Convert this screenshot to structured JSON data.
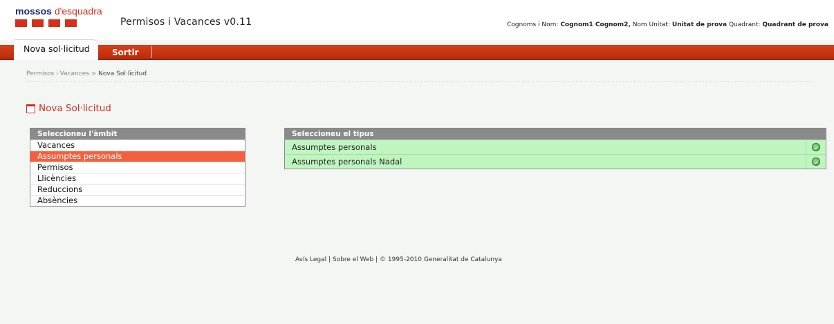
{
  "header": {
    "logo": {
      "bold": "mossos",
      "light": "d'esquadra"
    },
    "app_title": "Permisos i Vacances v0.11",
    "user": {
      "name_label": "Cognoms i Nom:",
      "name_value": "Cognom1 Cognom2,",
      "unit_label": "Nom Unitat:",
      "unit_value": "Unitat de prova",
      "quadrant_label": "Quadrant:",
      "quadrant_value": "Quadrant de prova"
    }
  },
  "nav": {
    "active_tab": "Nova sol·licitud",
    "sortir": "Sortir"
  },
  "breadcrumb": {
    "root": "Permisos i Vacances",
    "separator": ">",
    "current": "Nova Sol·licitud"
  },
  "page_title": "Nova Sol·licitud",
  "ambit": {
    "header": "Seleccioneu l'àmbit",
    "items": [
      {
        "label": "Vacances",
        "selected": false
      },
      {
        "label": "Assumptes personals",
        "selected": true
      },
      {
        "label": "Permisos",
        "selected": false
      },
      {
        "label": "Llicències",
        "selected": false
      },
      {
        "label": "Reduccions",
        "selected": false
      },
      {
        "label": "Absències",
        "selected": false
      }
    ]
  },
  "tipus": {
    "header": "Seleccioneu el tipus",
    "rows": [
      {
        "label": "Assumptes personals",
        "icon": "check-icon"
      },
      {
        "label": "Assumptes personals Nadal",
        "icon": "check-icon"
      }
    ]
  },
  "footer": {
    "legal": "Avís Legal",
    "about": "Sobre el Web",
    "copyright": "© 1995-2010 Generalitat de Catalunya"
  },
  "colors": {
    "brand_red": "#d4301c",
    "nav_red": "#c8360f",
    "selected": "#f4603e",
    "row_green": "#c0f5c0",
    "panel_header": "#8a8a8a"
  }
}
